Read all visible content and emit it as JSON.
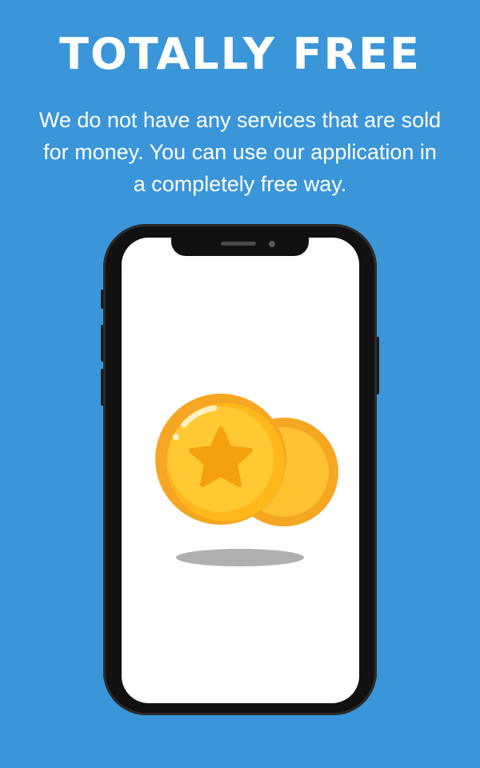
{
  "headline": "TOTALLY FREE",
  "subtitle": {
    "lines": [
      "We do not have any services that are sold",
      "for money. You can use our application in",
      "a completely free way."
    ]
  },
  "colors": {
    "background": "#3a96d9",
    "text": "#ffffff",
    "phone_frame": "#111111",
    "screen": "#ffffff",
    "coin_front": "#ffc233",
    "coin_edge": "#f5a623",
    "star": "#f5a00f",
    "shadow": "#b0b0b0"
  },
  "illustration": {
    "device": "smartphone-icon",
    "content": "gold-coins-icon"
  }
}
